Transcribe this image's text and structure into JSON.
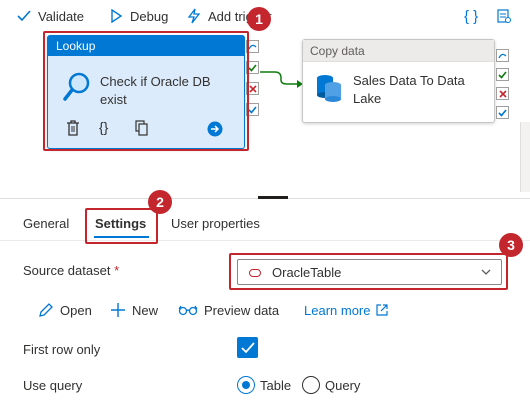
{
  "toolbar": {
    "validate_label": "Validate",
    "debug_label": "Debug",
    "add_trigger_label": "Add trigger"
  },
  "canvas": {
    "lookup": {
      "header": "Lookup",
      "title_line1": "Check if Oracle DB",
      "title_line2": "exist",
      "braces": "{}"
    },
    "copy_data": {
      "header": "Copy data",
      "title_line1": "Sales Data To Data",
      "title_line2": "Lake"
    }
  },
  "callouts": [
    "1",
    "2",
    "3"
  ],
  "tabs": {
    "general": "General",
    "settings": "Settings",
    "user_properties": "User properties"
  },
  "settings": {
    "source_dataset_label": "Source dataset",
    "required_marker": "*",
    "source_dataset_value": "OracleTable",
    "actions": {
      "open": "Open",
      "new": "New",
      "preview": "Preview data",
      "learn_more": "Learn more"
    },
    "first_row_only_label": "First row only",
    "first_row_only_checked": true,
    "use_query_label": "Use query",
    "use_query_options": [
      "Table",
      "Query"
    ],
    "use_query_selected": "Table"
  },
  "colors": {
    "accent": "#0078d4",
    "callout": "#c4262e",
    "success": "#107c10"
  }
}
